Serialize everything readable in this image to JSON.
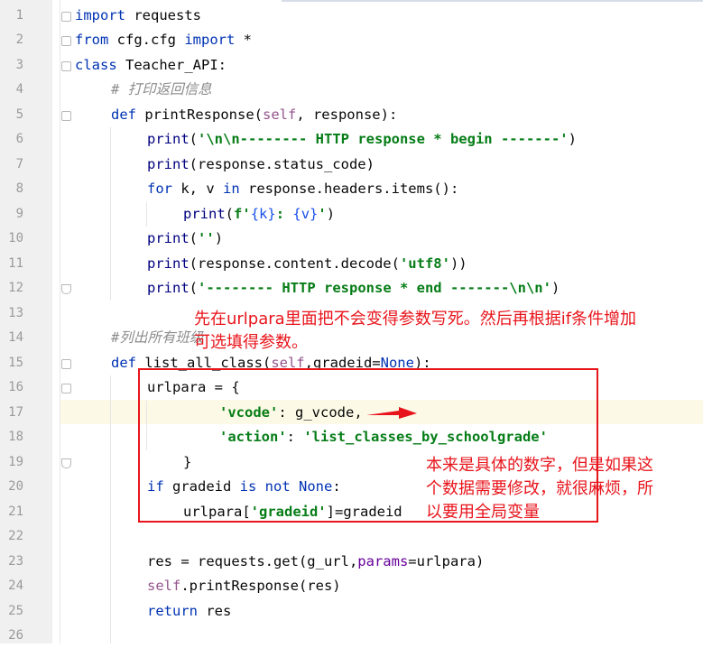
{
  "editor": {
    "line_numbers": [
      "1",
      "2",
      "3",
      "4",
      "5",
      "6",
      "7",
      "8",
      "9",
      "10",
      "11",
      "12",
      "13",
      "14",
      "15",
      "16",
      "17",
      "18",
      "19",
      "20",
      "21",
      "22",
      "23",
      "24",
      "25",
      "26"
    ],
    "lines": {
      "l1": {
        "kw1": "import",
        "rest": " requests"
      },
      "l2": {
        "kw1": "from",
        "mid": " cfg.cfg ",
        "kw2": "import",
        "rest": " *"
      },
      "l3": {
        "kw1": "class",
        "rest": " Teacher_API:"
      },
      "l4": {
        "comment": "# 打印返回信息"
      },
      "l5": {
        "kw1": "def",
        "name": " printResponse(",
        "self": "self",
        "rest": ", response):"
      },
      "l6": {
        "fn": "print",
        "open": "(",
        "str": "'\\n\\n-------- HTTP response * begin -------'",
        "close": ")"
      },
      "l7": {
        "fn": "print",
        "rest": "(response.status_code)"
      },
      "l8": {
        "kw1": "for",
        "mid": " k, v ",
        "kw2": "in",
        "rest": " response.headers.items():"
      },
      "l9": {
        "fn": "print",
        "open": "(",
        "fpre": "f'",
        "b1": "{k}",
        "colon": ": ",
        "b2": "{v}",
        "fpost": "'",
        "close": ")"
      },
      "l10": {
        "fn": "print",
        "open": "(",
        "str": "''",
        "close": ")"
      },
      "l11": {
        "fn": "print",
        "open": "(response.content.decode(",
        "str": "'utf8'",
        "close": "))"
      },
      "l12": {
        "fn": "print",
        "open": "(",
        "str": "'-------- HTTP response * end -------\\n\\n'",
        "close": ")"
      },
      "l14": {
        "comment": "#列出所有班级"
      },
      "l15": {
        "kw1": "def",
        "name": " list_all_class(",
        "self": "self",
        "mid": ",gradeid=",
        "kw2": "None",
        "rest": "):"
      },
      "l16": {
        "text": "urlpara = {"
      },
      "l17": {
        "str": "'vcode'",
        "rest": ": g_vcode,"
      },
      "l18": {
        "str": "'action'",
        "colon": ": ",
        "str2": "'list_classes_by_schoolgrade'"
      },
      "l19": {
        "text": "}"
      },
      "l20": {
        "kw1": "if",
        "mid": " gradeid ",
        "kw2": "is not",
        "kw3": " None",
        "rest": ":"
      },
      "l21": {
        "pre": "urlpara[",
        "str": "'gradeid'",
        "rest": "]=gradeid"
      },
      "l23": {
        "pre": "res = requests.get(g_url,",
        "param": "params",
        "rest": "=urlpara)"
      },
      "l24": {
        "self": "self",
        "rest": ".printResponse(res)"
      },
      "l25": {
        "kw1": "return",
        "rest": " res"
      }
    }
  },
  "annotations": {
    "top_note_line1": "先在urlpara里面把不会变得参数写死。然后再根据if条件增加",
    "top_note_line2": "可选填得参数。",
    "side_note_line1": "本来是具体的数字，但是如果这",
    "side_note_line2": "个数据需要修改，就很麻烦，所",
    "side_note_line3": "以要用全局变量"
  },
  "colors": {
    "annotation_red": "#e8141b",
    "keyword": "#0033b3",
    "string": "#067d17",
    "current_line": "#fcfae6"
  }
}
